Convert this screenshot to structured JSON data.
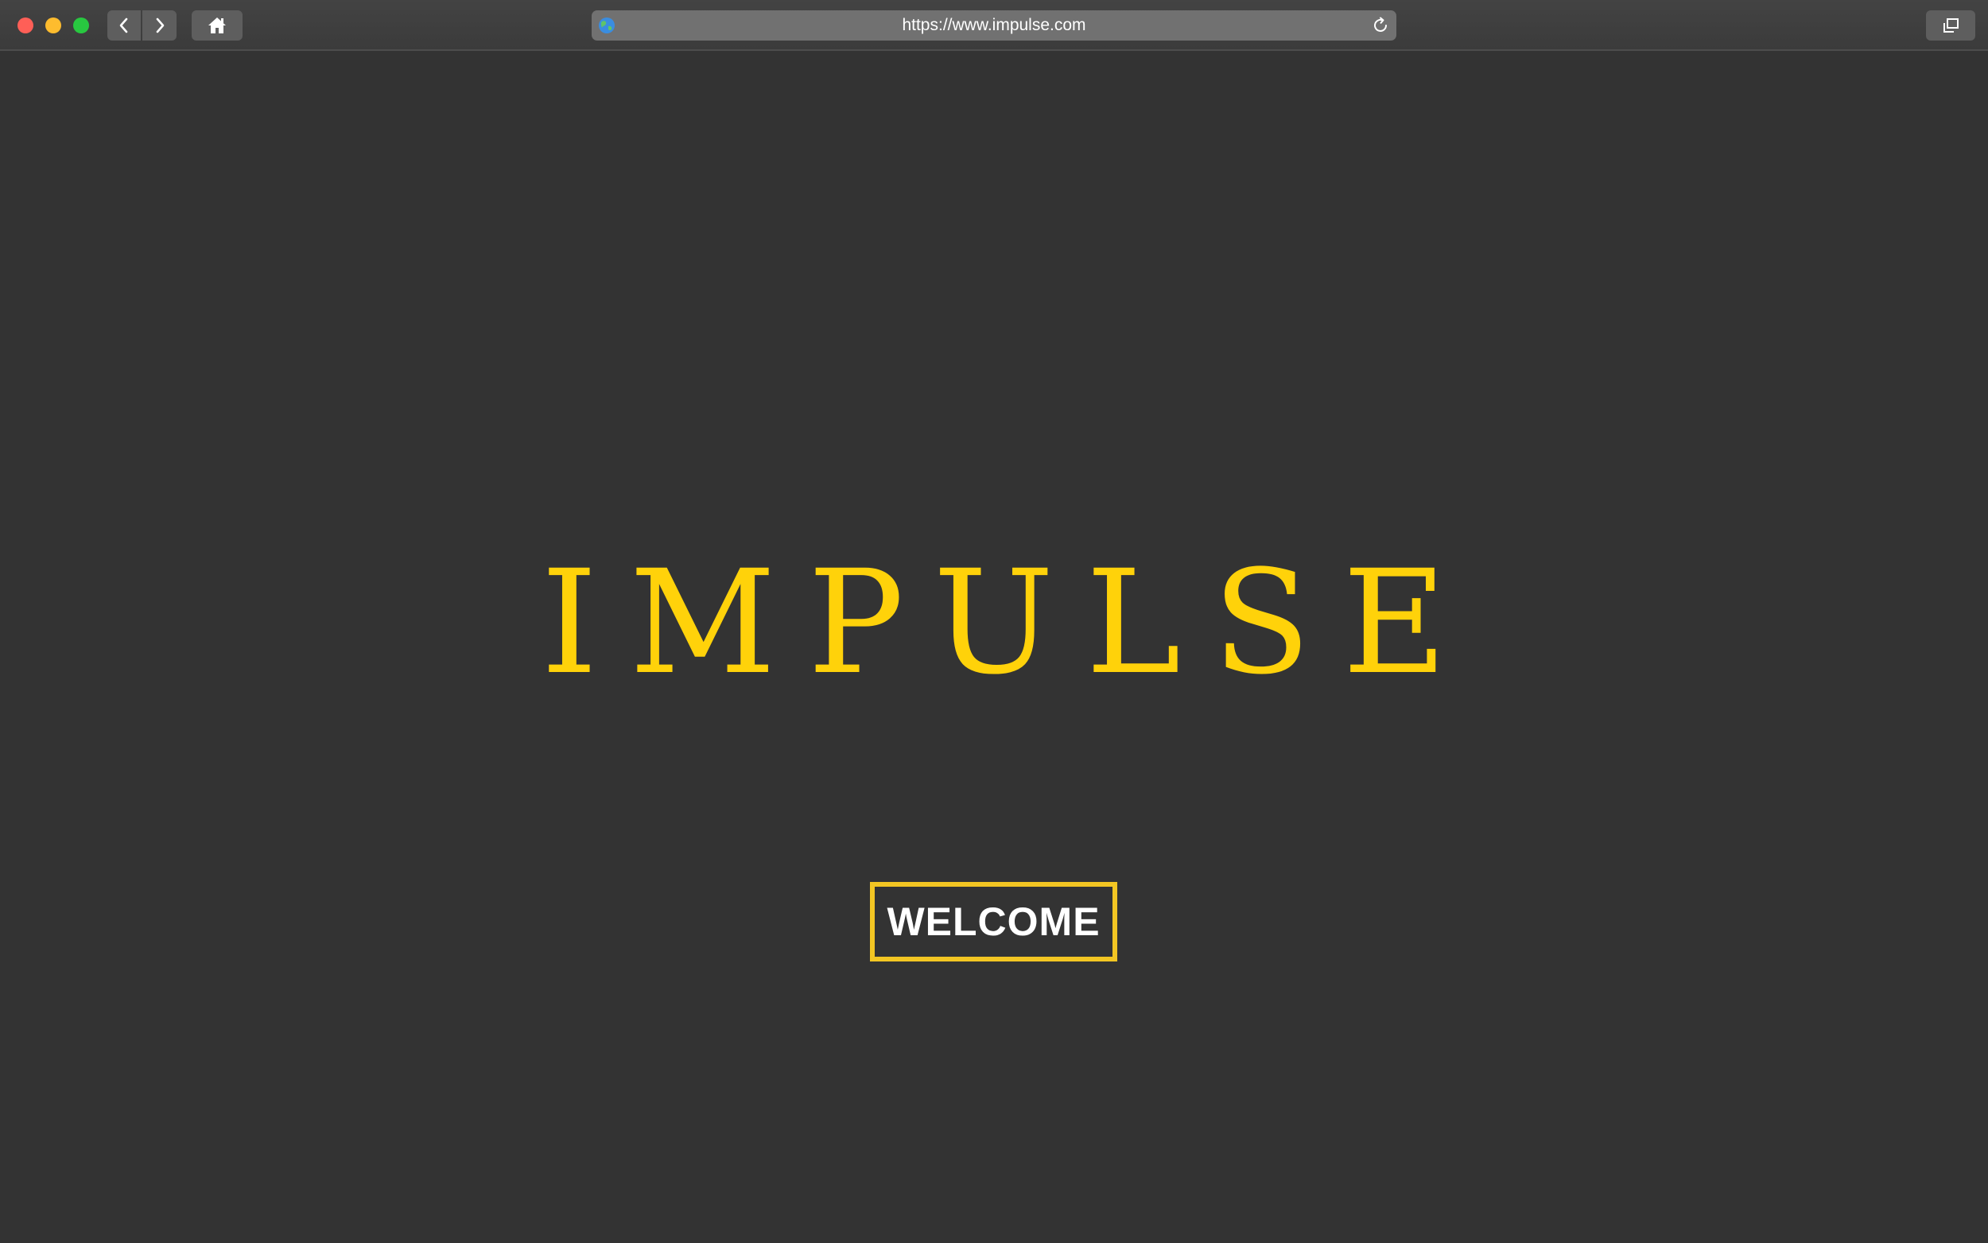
{
  "browser": {
    "url": "https://www.impulse.com",
    "icons": {
      "back": "chevron-left-icon",
      "forward": "chevron-right-icon",
      "home": "home-icon",
      "site": "globe-icon",
      "reload": "reload-icon",
      "tabs": "tab-overview-icon"
    },
    "traffic_colors": {
      "close": "#ff5f57",
      "minimize": "#febc2e",
      "zoom": "#28c840"
    }
  },
  "page": {
    "brand_title": "IMPULSE",
    "welcome_label": "WELCOME",
    "colors": {
      "background": "#333333",
      "accent": "#ffd20a",
      "button_border": "#f3c623",
      "button_text": "#ffffff"
    }
  }
}
